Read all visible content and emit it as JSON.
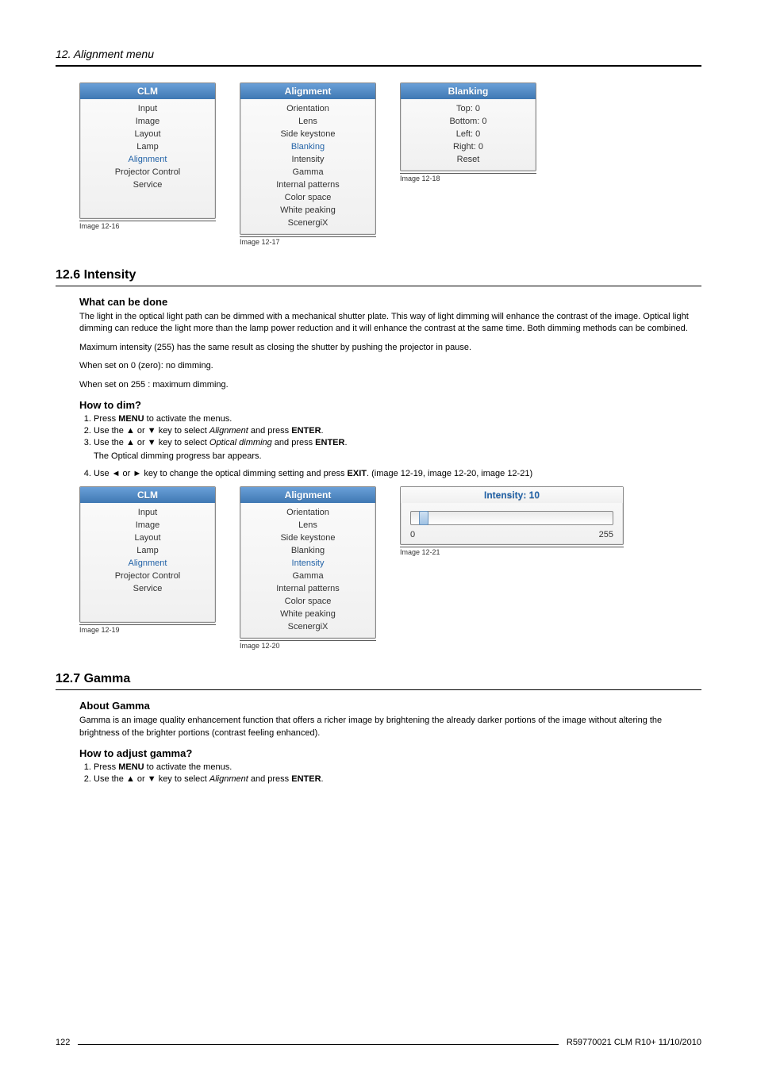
{
  "page_head": {
    "title": "12.  Alignment menu"
  },
  "menu_row_1": {
    "clm": {
      "title": "CLM",
      "items": [
        "Input",
        "Image",
        "Layout",
        "Lamp",
        "Alignment",
        "Projector Control",
        "Service"
      ],
      "selected": "Alignment",
      "caption": "Image 12-16"
    },
    "alignment": {
      "title": "Alignment",
      "items": [
        "Orientation",
        "Lens",
        "Side keystone",
        "Blanking",
        "Intensity",
        "Gamma",
        "Internal patterns",
        "Color space",
        "White peaking",
        "ScenergiX"
      ],
      "selected": "Blanking",
      "caption": "Image 12-17"
    },
    "blanking": {
      "title": "Blanking",
      "items": [
        "Top: 0",
        "Bottom: 0",
        "Left: 0",
        "Right: 0",
        "Reset"
      ],
      "caption": "Image 12-18"
    }
  },
  "section_12_6": {
    "number_title": "12.6  Intensity",
    "what_head": "What can be done",
    "what_para": "The light in the optical light path can be dimmed with a mechanical shutter plate.  This way of light dimming will enhance the contrast of the image.  Optical light dimming can reduce the light more than the lamp power reduction and it will enhance the contrast at the same time.  Both dimming methods can be combined.",
    "para_max": "Maximum intensity (255) has the same result as closing the shutter by pushing the projector in pause.",
    "para_zero": "When set on 0 (zero):  no dimming.",
    "para_255": "When set on 255 :  maximum dimming.",
    "how_head": "How to dim?",
    "step1_pre": "Press ",
    "step1_bold": "MENU",
    "step1_post": " to activate the menus.",
    "step2_pre": "Use the ▲ or ▼ key to select ",
    "step2_ital": "Alignment",
    "step2_mid": " and press ",
    "step2_bold": "ENTER",
    "step2_end": ".",
    "step3_pre": "Use the ▲ or ▼ key to select ",
    "step3_ital": "Optical dimming",
    "step3_mid": " and press ",
    "step3_bold": "ENTER",
    "step3_end": ".",
    "step3_note": "The Optical dimming progress bar appears.",
    "step4_pre": "Use ◄ or ► key to change the optical dimming setting and press ",
    "step4_bold": "EXIT",
    "step4_end": ". (image 12-19, image 12-20, image 12-21)"
  },
  "menu_row_2": {
    "clm": {
      "title": "CLM",
      "items": [
        "Input",
        "Image",
        "Layout",
        "Lamp",
        "Alignment",
        "Projector Control",
        "Service"
      ],
      "selected": "Alignment",
      "caption": "Image 12-19"
    },
    "alignment": {
      "title": "Alignment",
      "items": [
        "Orientation",
        "Lens",
        "Side keystone",
        "Blanking",
        "Intensity",
        "Gamma",
        "Internal patterns",
        "Color space",
        "White peaking",
        "ScenergiX"
      ],
      "selected": "Intensity",
      "caption": "Image 12-20"
    },
    "slider": {
      "title": "Intensity: 10",
      "min": "0",
      "max": "255",
      "caption": "Image 12-21"
    }
  },
  "section_12_7": {
    "number_title": "12.7  Gamma",
    "about_head": "About Gamma",
    "about_para": "Gamma is an image quality enhancement function that offers a richer image by brightening the already darker portions of the image without altering the brightness of the brighter portions (contrast feeling enhanced).",
    "how_head": "How to adjust gamma?",
    "step1_pre": "Press ",
    "step1_bold": "MENU",
    "step1_post": " to activate the menus.",
    "step2_pre": "Use the ▲ or ▼ key to select ",
    "step2_ital": "Alignment",
    "step2_mid": " and press ",
    "step2_bold": "ENTER",
    "step2_end": "."
  },
  "footer": {
    "page_no": "122",
    "doc_id": "R59770021  CLM R10+  11/10/2010"
  }
}
